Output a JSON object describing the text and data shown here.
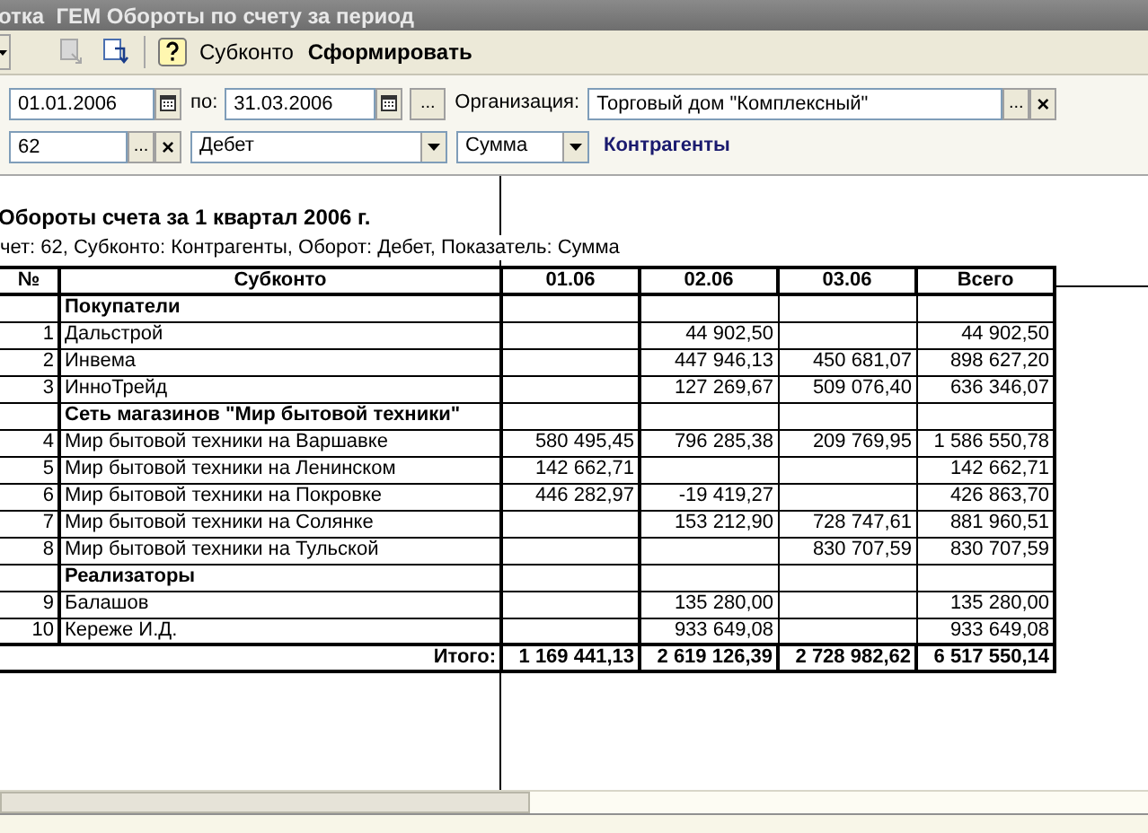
{
  "window": {
    "title": "отка  ГЕМ Обороты по счету за период"
  },
  "toolbar": {
    "subconto_button": "Субконто",
    "generate_button": "Сформировать"
  },
  "form": {
    "period_from": {
      "value": "01.01.2006"
    },
    "period_to_label": "по:",
    "period_to": {
      "value": "31.03.2006"
    },
    "more_button": "...",
    "organization": {
      "label": "Организация:",
      "value": "Торговый дом \"Комплексный\"",
      "select_button": "...",
      "clear_button": "×"
    },
    "account": {
      "value": "62",
      "select_button": "...",
      "clear_button": "×"
    },
    "turnover": {
      "value": "Дебет"
    },
    "indicator": {
      "value": "Сумма"
    },
    "subconto_link": "Контрагенты"
  },
  "report": {
    "title": "Обороты счета за 1 квартал 2006 г.",
    "subtitle": "чет: 62, Субконто: Контрагенты, Оборот: Дебет, Показатель: Сумма",
    "table": {
      "columns": [
        "№",
        "Субконто",
        "01.06",
        "02.06",
        "03.06",
        "Всего"
      ],
      "rows": [
        {
          "kind": "group",
          "name": "Покупатели"
        },
        {
          "kind": "item",
          "number": "1",
          "name": "Дальстрой",
          "m02": "44 902,50",
          "total": "44 902,50"
        },
        {
          "kind": "item",
          "number": "2",
          "name": "Инвема",
          "m02": "447 946,13",
          "m03": "450 681,07",
          "total": "898 627,20"
        },
        {
          "kind": "item",
          "number": "3",
          "name": "ИнноТрейд",
          "m02": "127 269,67",
          "m03": "509 076,40",
          "total": "636 346,07"
        },
        {
          "kind": "group",
          "name": "Сеть магазинов \"Мир бытовой техники\""
        },
        {
          "kind": "item",
          "number": "4",
          "name": "Мир бытовой техники на Варшавке",
          "m01": "580 495,45",
          "m02": "796 285,38",
          "m03": "209 769,95",
          "total": "1 586 550,78"
        },
        {
          "kind": "item",
          "number": "5",
          "name": "Мир бытовой техники на Ленинском",
          "m01": "142 662,71",
          "total": "142 662,71"
        },
        {
          "kind": "item",
          "number": "6",
          "name": "Мир бытовой техники на Покровке",
          "m01": "446 282,97",
          "m02": "-19 419,27",
          "total": "426 863,70"
        },
        {
          "kind": "item",
          "number": "7",
          "name": "Мир бытовой техники на Солянке",
          "m02": "153 212,90",
          "m03": "728 747,61",
          "total": "881 960,51"
        },
        {
          "kind": "item",
          "number": "8",
          "name": "Мир бытовой техники на Тульской",
          "m03": "830 707,59",
          "total": "830 707,59"
        },
        {
          "kind": "group",
          "name": "Реализаторы"
        },
        {
          "kind": "item",
          "number": "9",
          "name": "Балашов",
          "m02": "135 280,00",
          "total": "135 280,00"
        },
        {
          "kind": "item",
          "number": "10",
          "name": "Кереже И.Д.",
          "m02": "933 649,08",
          "total": "933 649,08"
        }
      ],
      "total": {
        "label": "Итого:",
        "values": [
          "1 169 441,13",
          "2 619 126,39",
          "2 728 982,62",
          "6 517 550,14"
        ]
      }
    }
  }
}
